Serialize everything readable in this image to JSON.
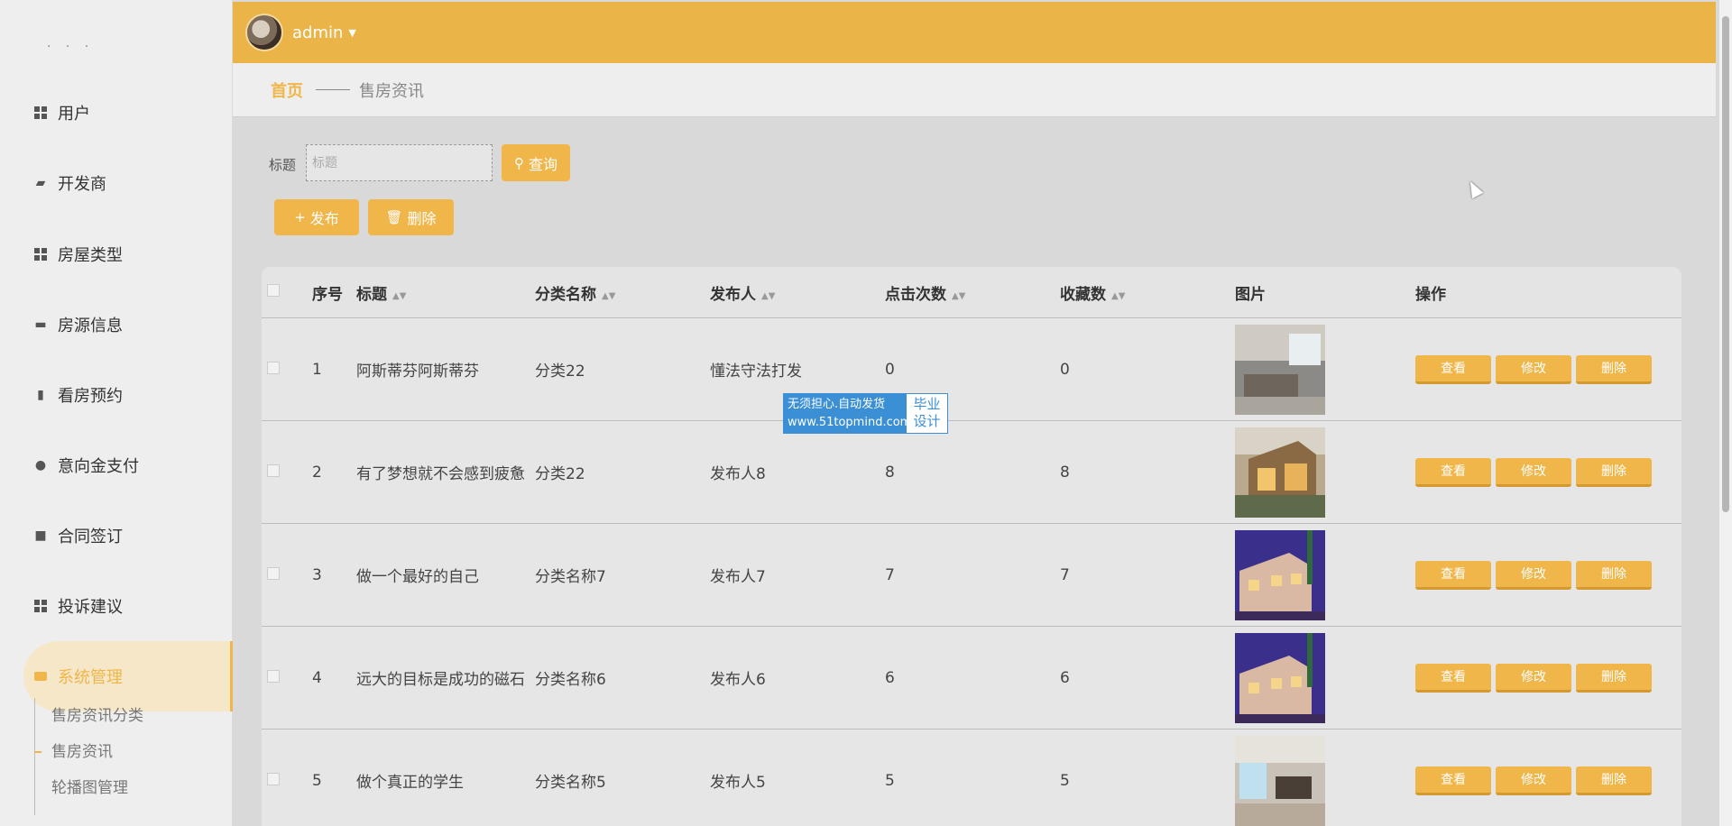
{
  "sidebar": {
    "dots": "· · ·",
    "items": [
      {
        "label": "用户",
        "icon": "grid-icon"
      },
      {
        "label": "开发商",
        "icon": "wallet-icon"
      },
      {
        "label": "房屋类型",
        "icon": "grid-icon"
      },
      {
        "label": "房源信息",
        "icon": "briefcase-icon"
      },
      {
        "label": "看房预约",
        "icon": "bars-icon"
      },
      {
        "label": "意向金支付",
        "icon": "user-icon"
      },
      {
        "label": "合同签订",
        "icon": "clipboard-icon"
      },
      {
        "label": "投诉建议",
        "icon": "grid-icon"
      },
      {
        "label": "系统管理",
        "icon": "monitor-icon"
      }
    ],
    "sub_items": [
      "售房资讯分类",
      "售房资讯",
      "轮播图管理"
    ]
  },
  "header": {
    "username": "admin"
  },
  "breadcrumb": {
    "home": "首页",
    "current": "售房资讯"
  },
  "search": {
    "label": "标题",
    "placeholder": "标题",
    "query_button": "查询"
  },
  "actions": {
    "publish": "发布",
    "delete": "删除"
  },
  "table": {
    "columns": [
      "序号",
      "标题",
      "分类名称",
      "发布人",
      "点击次数",
      "收藏数",
      "图片",
      "操作"
    ],
    "rows": [
      {
        "no": "1",
        "title": "阿斯蒂芬阿斯蒂芬",
        "category": "分类22",
        "publisher": "懂法守法打发",
        "clicks": "0",
        "favorites": "0"
      },
      {
        "no": "2",
        "title": "有了梦想就不会感到疲惫",
        "category": "分类22",
        "publisher": "发布人8",
        "clicks": "8",
        "favorites": "8"
      },
      {
        "no": "3",
        "title": "做一个最好的自己",
        "category": "分类名称7",
        "publisher": "发布人7",
        "clicks": "7",
        "favorites": "7"
      },
      {
        "no": "4",
        "title": "远大的目标是成功的磁石",
        "category": "分类名称6",
        "publisher": "发布人6",
        "clicks": "6",
        "favorites": "6"
      },
      {
        "no": "5",
        "title": "做个真正的学生",
        "category": "分类名称5",
        "publisher": "发布人5",
        "clicks": "5",
        "favorites": "5"
      }
    ],
    "ops": {
      "view": "查看",
      "edit": "修改",
      "delete": "删除"
    }
  },
  "watermark": {
    "line1": "无须担心.自动发货",
    "line2": "www.51topmind.com",
    "right1": "毕业",
    "right2": "设计"
  },
  "colors": {
    "accent": "#f0b64a",
    "header": "#eab448"
  }
}
